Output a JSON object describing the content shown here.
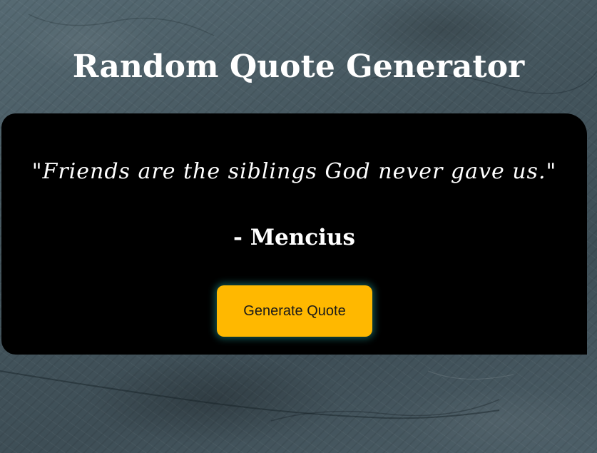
{
  "page": {
    "title": "Random Quote Generator"
  },
  "quote_card": {
    "quote": "\"Friends are the siblings God never gave us.\"",
    "author": "- Mencius",
    "button_label": "Generate Quote"
  },
  "colors": {
    "background": "#4a5a62",
    "card": "#000000",
    "button": "#ffb800",
    "button_glow": "#28b4aa",
    "text": "#ffffff"
  }
}
